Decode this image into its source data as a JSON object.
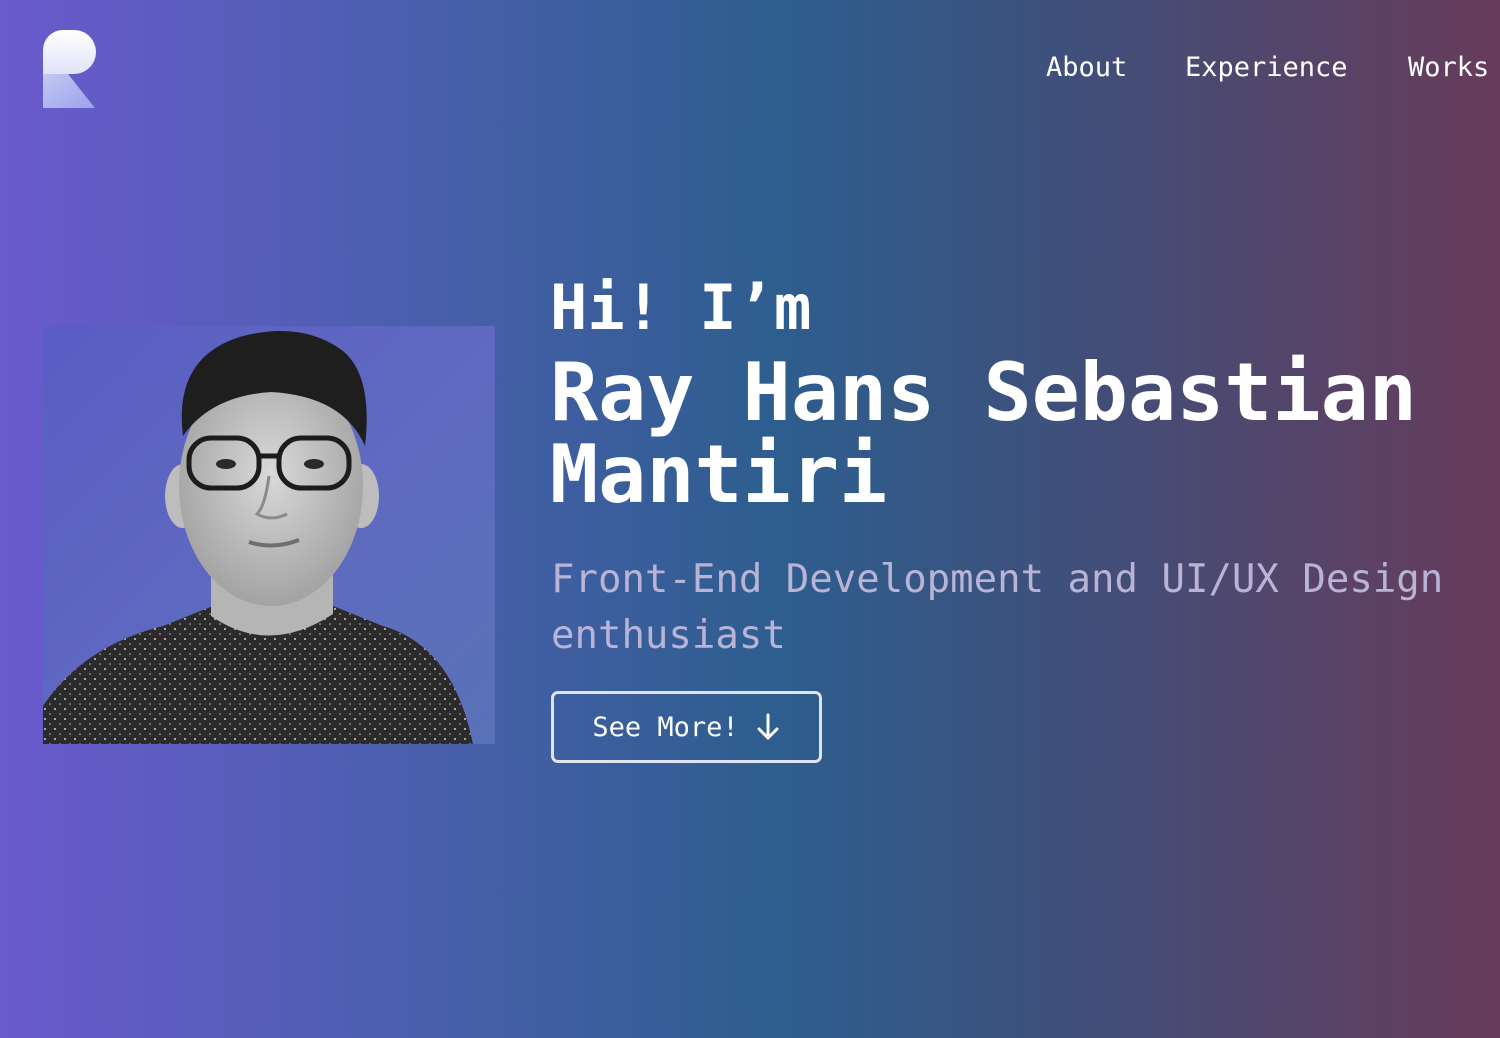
{
  "colors": {
    "gradient_left": "#6a5acd",
    "gradient_mid": "#2d5e8e",
    "gradient_right": "#673b5a",
    "tagline": "#b9b3d6",
    "button_border": "#dfe4f2"
  },
  "header": {
    "logo_icon": "r-logo-icon",
    "nav": {
      "about": "About",
      "experience": "Experience",
      "works": "Works"
    }
  },
  "hero": {
    "photo_icon": "profile-photo",
    "greeting": "Hi! I’m",
    "name": "Ray Hans Sebastian Mantiri",
    "tagline_line1": "Front-End Development and UI/UX Design",
    "tagline_line2": "enthusiast",
    "button_label": "See More!",
    "button_icon": "arrow-down-icon"
  }
}
